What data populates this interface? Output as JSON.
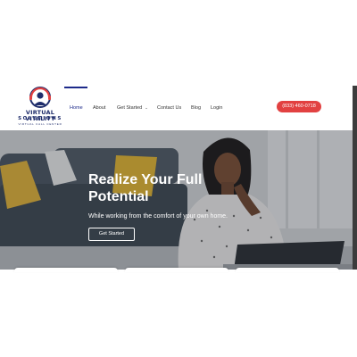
{
  "brand": {
    "name_line1": "VIRTUAL VITALITY",
    "name_line2": "SOLUTIONS",
    "tagline": "VIRTUAL CALL CENTER"
  },
  "nav": {
    "items": [
      {
        "label": "Home",
        "active": true
      },
      {
        "label": "About",
        "active": false
      },
      {
        "label": "Get Started",
        "active": false,
        "has_dropdown": true
      },
      {
        "label": "Contact Us",
        "active": false
      },
      {
        "label": "Blog",
        "active": false
      },
      {
        "label": "Login",
        "active": false
      }
    ],
    "dropdown_glyph": "⌄",
    "phone_label": "(833) 460-0718"
  },
  "hero": {
    "title": "Realize Your Full\nPotential",
    "subtitle": "While working from the comfort of your own home.",
    "cta_label": "Get Started"
  },
  "colors": {
    "brand_navy": "#1f2d6b",
    "nav_active": "#1d2a8a",
    "phone_button": "#e24141",
    "hero_overlay": "#1c1f26"
  },
  "icons": {
    "logo_mark": "headset-person-icon"
  }
}
